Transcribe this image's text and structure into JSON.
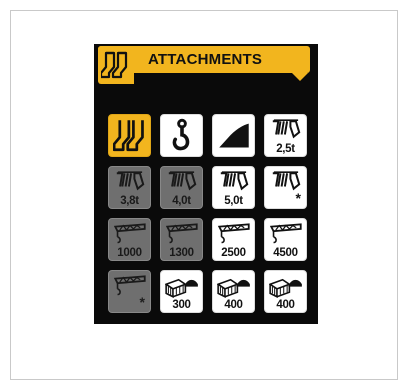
{
  "header": {
    "title": "ATTACHMENTS",
    "accent_color": "#f2b51e",
    "icon": "attachment-forks-icon"
  },
  "grid": [
    {
      "name": "tile-forks",
      "icon": "forks-icon",
      "label": "",
      "style": "selected",
      "interactable": true
    },
    {
      "name": "tile-hook",
      "icon": "hook-icon",
      "label": "",
      "style": "enabled",
      "interactable": true
    },
    {
      "name": "tile-bucket",
      "icon": "bucket-icon",
      "label": "",
      "style": "enabled",
      "interactable": true
    },
    {
      "name": "tile-winch-2-5t",
      "icon": "winch-icon",
      "label": "2,5t",
      "style": "enabled",
      "interactable": true
    },
    {
      "name": "tile-winch-3-8t",
      "icon": "winch-icon",
      "label": "3,8t",
      "style": "disabled",
      "interactable": true
    },
    {
      "name": "tile-winch-4-0t",
      "icon": "winch-icon",
      "label": "4,0t",
      "style": "disabled",
      "interactable": true
    },
    {
      "name": "tile-winch-5-0t",
      "icon": "winch-icon",
      "label": "5,0t",
      "style": "enabled",
      "interactable": true
    },
    {
      "name": "tile-winch-custom",
      "icon": "winch-icon",
      "label": "*",
      "style": "enabled",
      "interactable": true
    },
    {
      "name": "tile-jib-1000",
      "icon": "jib-icon",
      "label": "1000",
      "style": "disabled",
      "interactable": true
    },
    {
      "name": "tile-jib-1300",
      "icon": "jib-icon",
      "label": "1300",
      "style": "disabled",
      "interactable": true
    },
    {
      "name": "tile-jib-2500",
      "icon": "jib-icon",
      "label": "2500",
      "style": "enabled",
      "interactable": true
    },
    {
      "name": "tile-jib-4500",
      "icon": "jib-icon",
      "label": "4500",
      "style": "enabled",
      "interactable": true
    },
    {
      "name": "tile-jib-custom",
      "icon": "jib-icon",
      "label": "*",
      "style": "disabled",
      "interactable": true
    },
    {
      "name": "tile-platform-300",
      "icon": "platform-icon",
      "label": "300",
      "style": "enabled",
      "interactable": true
    },
    {
      "name": "tile-platform-400a",
      "icon": "platform-icon",
      "label": "400",
      "style": "enabled",
      "interactable": true
    },
    {
      "name": "tile-platform-400b",
      "icon": "platform-icon",
      "label": "400",
      "style": "enabled",
      "interactable": true
    }
  ]
}
